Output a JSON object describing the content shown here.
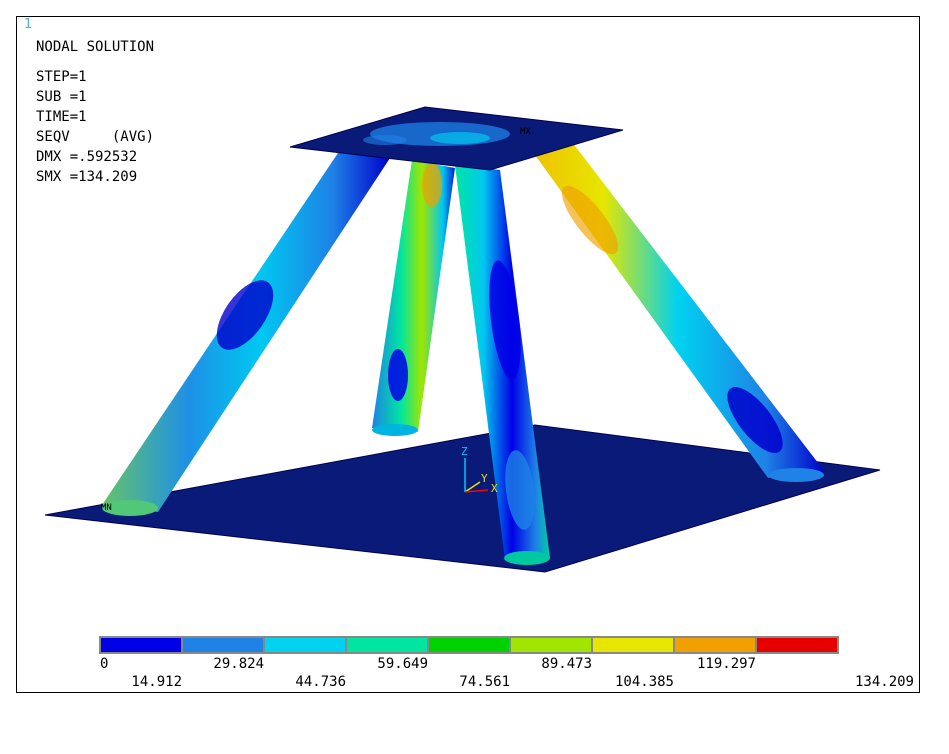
{
  "window": {
    "number": "1"
  },
  "info": {
    "title": "NODAL SOLUTION",
    "step": "STEP=1",
    "sub": "SUB =1",
    "time": "TIME=1",
    "seqv": "SEQV     (AVG)",
    "dmx": "DMX =.592532",
    "smx": "SMX =134.209"
  },
  "markers": {
    "mn": "MN",
    "mx": "MX"
  },
  "triad": {
    "z": "Z",
    "y": "Y",
    "x": "X"
  },
  "legend": {
    "colors": [
      "#0000e6",
      "#1e82e6",
      "#00d2f0",
      "#00e6a0",
      "#00d200",
      "#a0e600",
      "#e6e600",
      "#f0a000",
      "#e60000"
    ],
    "ticks": [
      "0",
      "14.912",
      "29.824",
      "44.736",
      "59.649",
      "74.561",
      "89.473",
      "104.385",
      "119.297",
      "134.209"
    ]
  },
  "colors": {
    "plate": "#0a1a78",
    "edge": "#000050"
  }
}
